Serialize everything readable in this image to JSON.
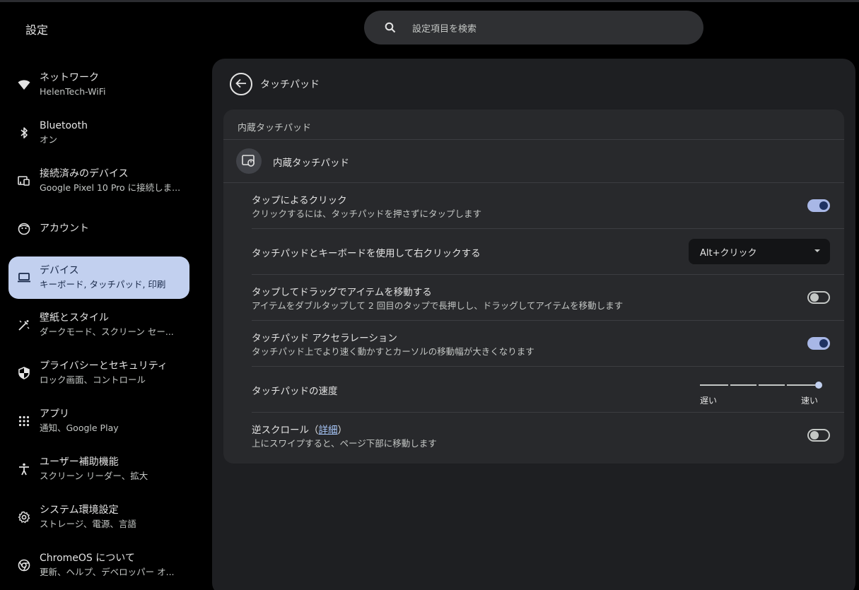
{
  "app_title": "設定",
  "search": {
    "placeholder": "設定項目を検索",
    "icon": "search-icon"
  },
  "sidebar": {
    "items": [
      {
        "label": "ネットワーク",
        "sub": "HelenTech-WiFi",
        "icon": "wifi-icon",
        "active": false
      },
      {
        "label": "Bluetooth",
        "sub": "オン",
        "icon": "bluetooth-icon",
        "active": false
      },
      {
        "label": "接続済みのデバイス",
        "sub": "Google Pixel 10 Pro に接続しま...",
        "icon": "connected-devices-icon",
        "active": false
      },
      {
        "label": "アカウント",
        "sub": "",
        "icon": "account-icon",
        "active": false
      },
      {
        "label": "デバイス",
        "sub": "キーボード, タッチパッド, 印刷",
        "icon": "laptop-icon",
        "active": true
      },
      {
        "label": "壁紙とスタイル",
        "sub": "ダークモード、スクリーン セー...",
        "icon": "palette-icon",
        "active": false
      },
      {
        "label": "プライバシーとセキュリティ",
        "sub": "ロック画面、コントロール",
        "icon": "shield-icon",
        "active": false
      },
      {
        "label": "アプリ",
        "sub": "通知、Google Play",
        "icon": "apps-grid-icon",
        "active": false
      },
      {
        "label": "ユーザー補助機能",
        "sub": "スクリーン リーダー、拡大",
        "icon": "accessibility-icon",
        "active": false
      },
      {
        "label": "システム環境設定",
        "sub": "ストレージ、電源、言語",
        "icon": "gear-icon",
        "active": false
      },
      {
        "label": "ChromeOS について",
        "sub": "更新、ヘルプ、デベロッパー オ...",
        "icon": "chrome-icon",
        "active": false
      }
    ]
  },
  "page": {
    "title": "タッチパッド"
  },
  "card": {
    "header": "内蔵タッチパッド",
    "device_name": "内蔵タッチパッド",
    "settings": {
      "tap_to_click": {
        "label": "タップによるクリック",
        "sub": "クリックするには、タッチパッドを押さずにタップします",
        "on": true
      },
      "right_click": {
        "label": "タッチパッドとキーボードを使用して右クリックする",
        "value": "Alt+クリック"
      },
      "tap_drag": {
        "label": "タップしてドラッグでアイテムを移動する",
        "sub": "アイテムをダブルタップして 2 回目のタップで長押しし、ドラッグしてアイテムを移動します",
        "on": false
      },
      "acceleration": {
        "label": "タッチパッド アクセラレーション",
        "sub": "タッチパッド上でより速く動かすとカーソルの移動幅が大きくなります",
        "on": true
      },
      "speed": {
        "label": "タッチパッドの速度",
        "min_label": "遅い",
        "max_label": "速い",
        "value": 5,
        "max": 5
      },
      "reverse_scroll": {
        "label_prefix": "逆スクロール（",
        "link": "詳細",
        "label_suffix": "）",
        "sub": "上にスワイプすると、ページ下部に移動します",
        "on": false
      }
    }
  },
  "colors": {
    "accent": "#c2d0ef",
    "toggle_on": "#a8b7e6",
    "link": "#a8c7fa",
    "panel": "#1e1f22",
    "card": "#28292c"
  }
}
